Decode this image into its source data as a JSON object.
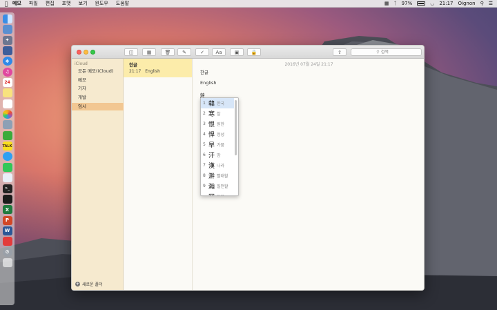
{
  "menubar": {
    "app_name": "메모",
    "items": [
      "파일",
      "편집",
      "포맷",
      "보기",
      "윈도우",
      "도움말"
    ],
    "battery": "97%",
    "time": "21:17",
    "user": "Oignon"
  },
  "toolbar": {
    "search_placeholder": "검색"
  },
  "sidebar": {
    "section": "iCloud",
    "items": [
      {
        "label": "모든 메모(iCloud)"
      },
      {
        "label": "메모"
      },
      {
        "label": "기자"
      },
      {
        "label": "개발"
      },
      {
        "label": "임시"
      }
    ],
    "new_folder_label": "새로운 폴더"
  },
  "note_list": {
    "notes": [
      {
        "title": "한글",
        "time": "21:17",
        "preview": "English"
      }
    ]
  },
  "editor": {
    "date": "2016년 07월 24일 21:17",
    "lines": [
      "한글",
      "English",
      "韓"
    ]
  },
  "candidates": [
    {
      "num": "1",
      "hanja": "韓",
      "gloss": "한국"
    },
    {
      "num": "2",
      "hanja": "寒",
      "gloss": "찰"
    },
    {
      "num": "3",
      "hanja": "恨",
      "gloss": "원한"
    },
    {
      "num": "4",
      "hanja": "悍",
      "gloss": "정성"
    },
    {
      "num": "5",
      "hanja": "旱",
      "gloss": "가뭄"
    },
    {
      "num": "6",
      "hanja": "汗",
      "gloss": "땀"
    },
    {
      "num": "7",
      "hanja": "漢",
      "gloss": "나라"
    },
    {
      "num": "8",
      "hanja": "澣",
      "gloss": "빨래할"
    },
    {
      "num": "9",
      "hanja": "瀚",
      "gloss": "질펀할"
    },
    {
      "num": "",
      "hanja": "罕",
      "gloss": "드물"
    }
  ],
  "colors": {
    "sidebar_bg": "#f6eacf",
    "sidebar_selected": "#f2c792",
    "note_selected": "#fcecaa"
  }
}
